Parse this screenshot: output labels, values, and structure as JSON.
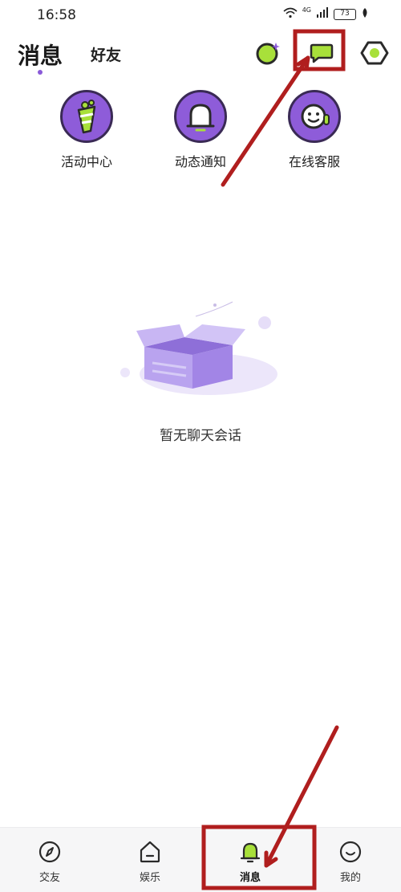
{
  "status_bar": {
    "time": "16:58",
    "network": "4G",
    "battery": "73"
  },
  "header": {
    "title": "消息",
    "friends_tab": "好友",
    "icons": [
      "planet-icon",
      "chat-bubble-icon",
      "hexagon-icon"
    ]
  },
  "quick_entries": [
    {
      "label": "活动中心",
      "icon": "party-cup-icon"
    },
    {
      "label": "动态通知",
      "icon": "bell-icon"
    },
    {
      "label": "在线客服",
      "icon": "support-face-icon"
    }
  ],
  "empty_state": {
    "text": "暂无聊天会话",
    "icon": "empty-box-icon"
  },
  "bottom_nav": {
    "items": [
      {
        "label": "交友",
        "icon": "compass-icon",
        "active": false
      },
      {
        "label": "娱乐",
        "icon": "house-icon",
        "active": false
      },
      {
        "label": "消息",
        "icon": "bell-icon",
        "active": true
      },
      {
        "label": "我的",
        "icon": "smile-icon",
        "active": false
      }
    ]
  },
  "colors": {
    "accent_purple": "#8e5cd9",
    "accent_green": "#a8e03a",
    "annotation_red": "#b01e1e"
  }
}
